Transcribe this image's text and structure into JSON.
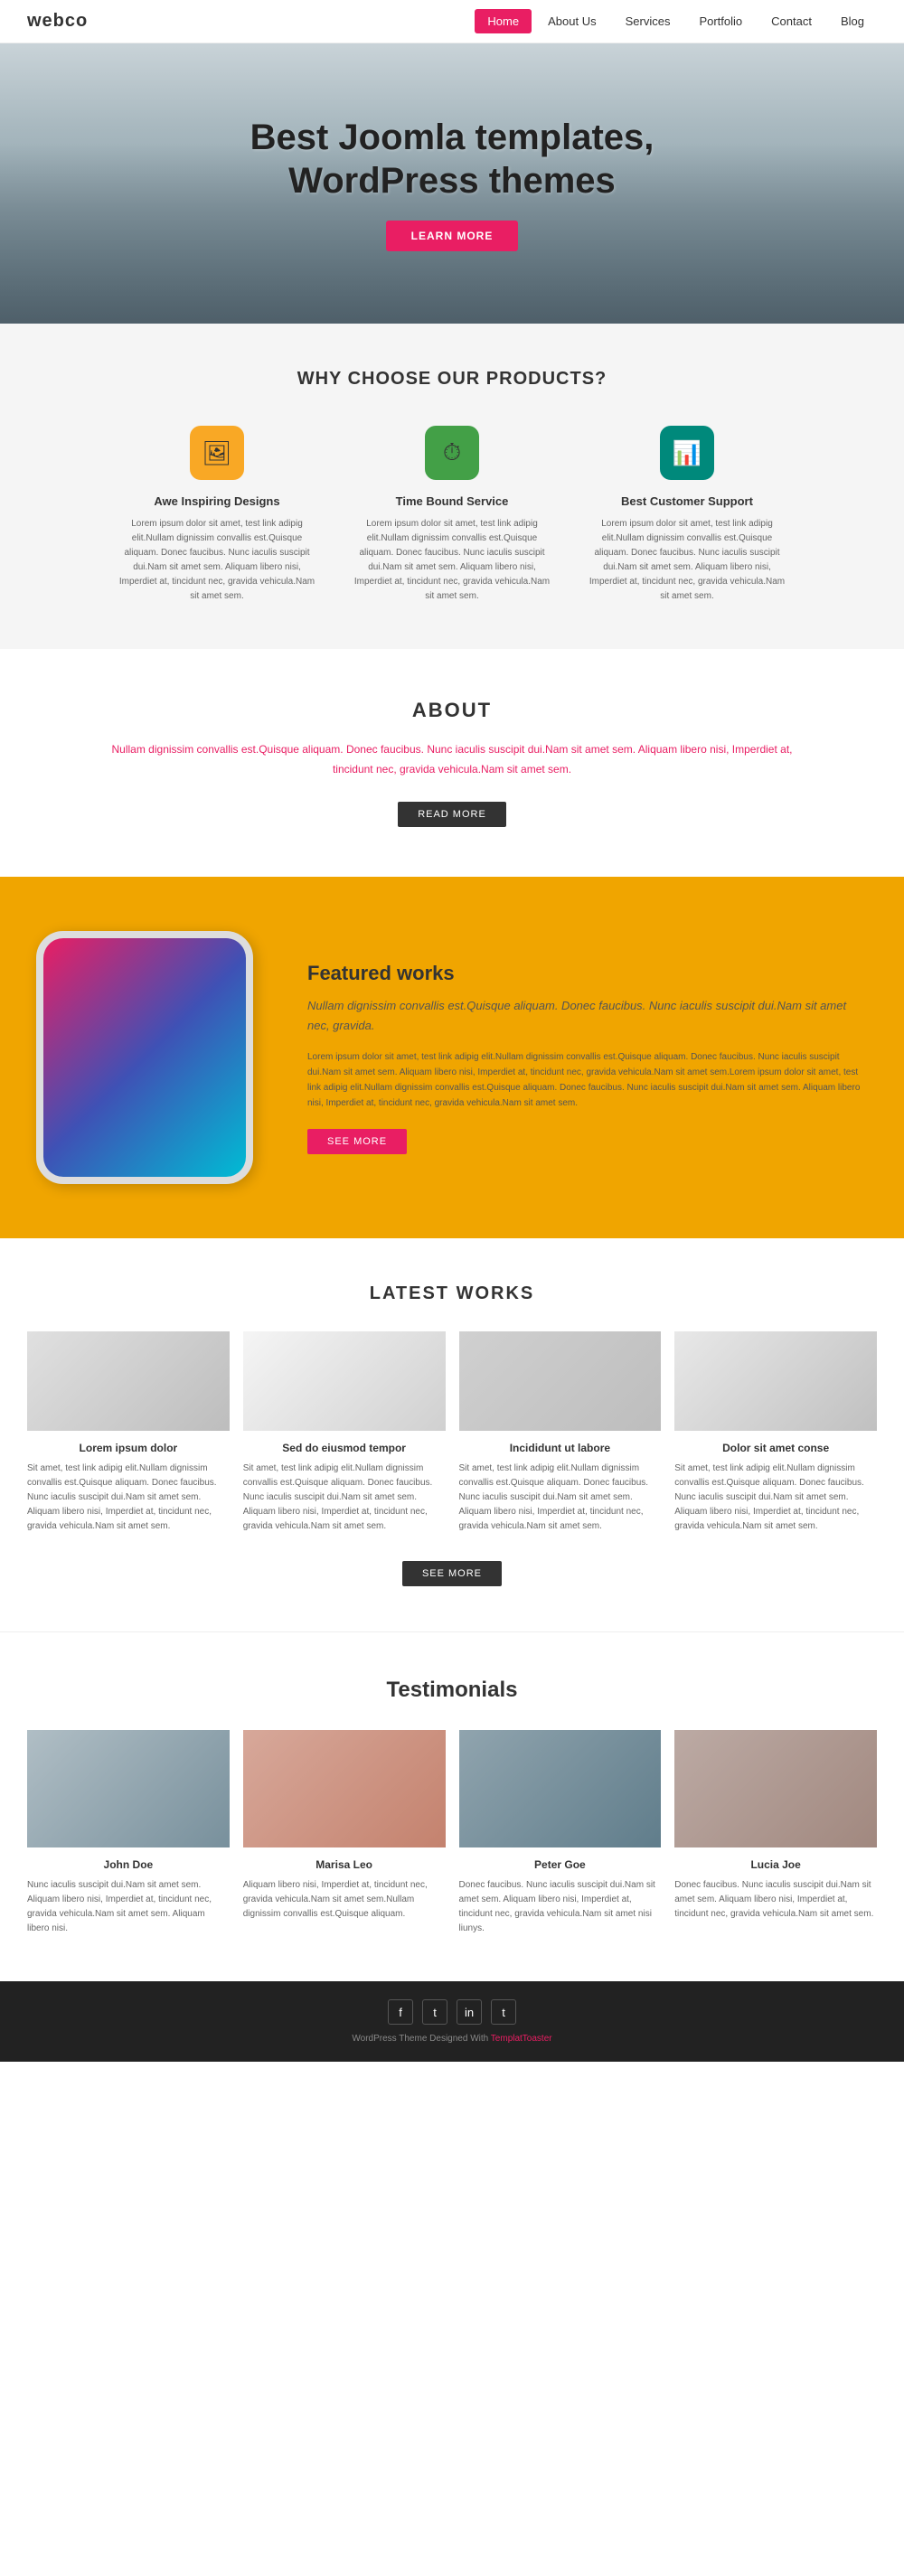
{
  "nav": {
    "logo": "webco",
    "links": [
      {
        "label": "Home",
        "active": true
      },
      {
        "label": "About Us",
        "active": false
      },
      {
        "label": "Services",
        "active": false
      },
      {
        "label": "Portfolio",
        "active": false
      },
      {
        "label": "Contact",
        "active": false
      },
      {
        "label": "Blog",
        "active": false
      }
    ]
  },
  "hero": {
    "headline1": "Best Joomla templates,",
    "headline2": "WordPress themes",
    "cta": "LEARN MORE"
  },
  "why": {
    "heading": "WHY CHOOSE OUR PRODUCTS?",
    "items": [
      {
        "title": "Awe Inspiring Designs",
        "icon": "🖼",
        "iconClass": "icon-yellow",
        "text": "Lorem ipsum dolor sit amet, test link adipig elit.Nullam dignissim convallis est.Quisque aliquam. Donec faucibus. Nunc iaculis suscipit dui.Nam sit amet sem. Aliquam libero nisi, Imperdiet at, tincidunt nec, gravida vehicula.Nam sit amet sem."
      },
      {
        "title": "Time Bound Service",
        "icon": "⏱",
        "iconClass": "icon-green",
        "text": "Lorem ipsum dolor sit amet, test link adipig elit.Nullam dignissim convallis est.Quisque aliquam. Donec faucibus. Nunc iaculis suscipit dui.Nam sit amet sem. Aliquam libero nisi, Imperdiet at, tincidunt nec, gravida vehicula.Nam sit amet sem."
      },
      {
        "title": "Best Customer Support",
        "icon": "📊",
        "iconClass": "icon-teal",
        "text": "Lorem ipsum dolor sit amet, test link adipig elit.Nullam dignissim convallis est.Quisque aliquam. Donec faucibus. Nunc iaculis suscipit dui.Nam sit amet sem. Aliquam libero nisi, Imperdiet at, tincidunt nec, gravida vehicula.Nam sit amet sem."
      }
    ]
  },
  "about": {
    "heading": "ABOUT",
    "text": "Nullam dignissim convallis est.Quisque aliquam. Donec faucibus. Nunc iaculis suscipit dui.Nam sit amet sem. Aliquam libero nisi, Imperdiet at, tincidunt nec, gravida vehicula.Nam sit amet sem.",
    "cta": "READ MORE"
  },
  "featured": {
    "heading": "Featured works",
    "subtitle": "Nullam dignissim convallis est.Quisque aliquam. Donec faucibus. Nunc iaculis suscipit dui.Nam sit amet nec, gravida.",
    "text": "Lorem ipsum dolor sit amet, test link adipig elit.Nullam dignissim convallis est.Quisque aliquam. Donec faucibus. Nunc iaculis suscipit dui.Nam sit amet sem. Aliquam libero nisi, Imperdiet at, tincidunt nec, gravida vehicula.Nam sit amet sem.Lorem ipsum dolor sit amet, test link adipig elit.Nullam dignissim convallis est.Quisque aliquam. Donec faucibus. Nunc iaculis suscipit dui.Nam sit amet sem. Aliquam libero nisi, Imperdiet at, tincidunt nec, gravida vehicula.Nam sit amet sem.",
    "cta": "SEE MORE"
  },
  "latest": {
    "heading": "LATEST WORKS",
    "items": [
      {
        "title": "Lorem ipsum dolor",
        "text": "Sit amet, test link adipig elit.Nullam dignissim convallis est.Quisque aliquam. Donec faucibus. Nunc iaculis suscipit dui.Nam sit amet sem. Aliquam libero nisi, Imperdiet at, tincidunt nec, gravida vehicula.Nam sit amet sem."
      },
      {
        "title": "Sed do eiusmod tempor",
        "text": "Sit amet, test link adipig elit.Nullam dignissim convallis est.Quisque aliquam. Donec faucibus. Nunc iaculis suscipit dui.Nam sit amet sem. Aliquam libero nisi, Imperdiet at, tincidunt nec, gravida vehicula.Nam sit amet sem."
      },
      {
        "title": "Incididunt ut labore",
        "text": "Sit amet, test link adipig elit.Nullam dignissim convallis est.Quisque aliquam. Donec faucibus. Nunc iaculis suscipit dui.Nam sit amet sem. Aliquam libero nisi, Imperdiet at, tincidunt nec, gravida vehicula.Nam sit amet sem."
      },
      {
        "title": "Dolor sit amet conse",
        "text": "Sit amet, test link adipig elit.Nullam dignissim convallis est.Quisque aliquam. Donec faucibus. Nunc iaculis suscipit dui.Nam sit amet sem. Aliquam libero nisi, Imperdiet at, tincidunt nec, gravida vehicula.Nam sit amet sem."
      }
    ],
    "cta": "SEE MORE"
  },
  "testimonials": {
    "heading": "Testimonials",
    "items": [
      {
        "name": "John Doe",
        "photoClass": "photo-1",
        "text": "Nunc iaculis suscipit dui.Nam sit amet sem. Aliquam libero nisi, Imperdiet at, tincidunt nec, gravida vehicula.Nam sit amet sem. Aliquam libero nisi."
      },
      {
        "name": "Marisa Leo",
        "photoClass": "photo-2",
        "text": "Aliquam libero nisi, Imperdiet at, tincidunt nec, gravida vehicula.Nam sit amet sem.Nullam dignissim convallis est.Quisque aliquam."
      },
      {
        "name": "Peter Goe",
        "photoClass": "photo-3",
        "text": "Donec faucibus. Nunc iaculis suscipit dui.Nam sit amet sem. Aliquam libero nisi, Imperdiet at, tincidunt nec, gravida vehicula.Nam sit amet nisi liunys."
      },
      {
        "name": "Lucia Joe",
        "photoClass": "photo-4",
        "text": "Donec faucibus. Nunc iaculis suscipit dui.Nam sit amet sem. Aliquam libero nisi, Imperdiet at, tincidunt nec, gravida vehicula.Nam sit amet sem."
      }
    ]
  },
  "footer": {
    "social": [
      "f",
      "t",
      "in",
      "t2"
    ],
    "text": "WordPress Theme Designed With TemplatToaster"
  }
}
